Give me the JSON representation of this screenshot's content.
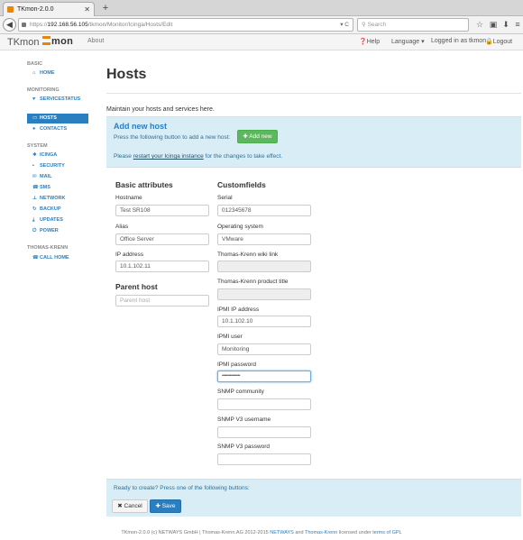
{
  "browser": {
    "tab_title": "TKmon-2.0.0",
    "url_scheme": "https://",
    "url_host": "192.168.56.105",
    "url_path": "/tkmon/Monitor/Icinga/Hosts/Edit",
    "url_controls": "▾ C",
    "search_placeholder": "Search"
  },
  "app": {
    "brand": "TKmon",
    "logo": "mon",
    "nav_about": "About",
    "nav_help": "Help",
    "nav_language": "Language",
    "nav_logged_in": "Logged in as tkmon",
    "nav_logout": "Logout"
  },
  "sidebar": {
    "sections": [
      {
        "header": "BASIC",
        "items": [
          {
            "label": "HOME",
            "icon": "home-icon"
          }
        ]
      },
      {
        "header": "MONITORING",
        "items": [
          {
            "label": "SERVICESTATUS",
            "icon": "heart-icon"
          }
        ]
      },
      {
        "header": "",
        "items": [
          {
            "label": "HOSTS",
            "icon": "monitor-icon",
            "active": true
          },
          {
            "label": "CONTACTS",
            "icon": "user-icon"
          }
        ]
      },
      {
        "header": "SYSTEM",
        "items": [
          {
            "label": "ICINGA",
            "icon": "icinga-icon"
          },
          {
            "label": "SECURITY",
            "icon": "lock-icon"
          },
          {
            "label": "MAIL",
            "icon": "mail-icon"
          },
          {
            "label": "SMS",
            "icon": "phone-icon"
          },
          {
            "label": "NETWORK",
            "icon": "network-icon"
          },
          {
            "label": "BACKUP",
            "icon": "refresh-icon"
          },
          {
            "label": "UPDATES",
            "icon": "download-icon"
          },
          {
            "label": "POWER",
            "icon": "power-icon"
          }
        ]
      },
      {
        "header": "THOMAS-KRENN",
        "items": [
          {
            "label": "CALL HOME",
            "icon": "phone-icon"
          }
        ]
      }
    ]
  },
  "main": {
    "title": "Hosts",
    "intro": "Maintain your hosts and services here.",
    "add": {
      "title": "Add new host",
      "desc": "Press the following button to add a new host:",
      "button": "Add new",
      "note_pre": "Please ",
      "note_link": "restart your Icinga instance",
      "note_post": " for the changes to take effect."
    },
    "basic": {
      "title": "Basic attributes",
      "hostname_label": "Hostname",
      "hostname_value": "Test SR108",
      "alias_label": "Alias",
      "alias_value": "Office Server",
      "ip_label": "IP address",
      "ip_value": "10.1.102.11"
    },
    "parent": {
      "title": "Parent host",
      "placeholder": "Parent host"
    },
    "custom": {
      "title": "Customfields",
      "serial_label": "Serial",
      "serial_value": "012345678",
      "os_label": "Operating system",
      "os_value": "VMware",
      "wiki_label": "Thomas-Krenn wiki link",
      "wiki_value": "",
      "product_label": "Thomas-Krenn product title",
      "product_value": "",
      "ipmi_ip_label": "IPMI IP address",
      "ipmi_ip_value": "10.1.102.10",
      "ipmi_user_label": "IPMI user",
      "ipmi_user_value": "Monitoring",
      "ipmi_pw_label": "IPMI password",
      "ipmi_pw_value": "••••••••••••••••",
      "snmp_comm_label": "SNMP community",
      "snmp_comm_value": "",
      "snmp_v3_user_label": "SNMP V3 username",
      "snmp_v3_user_value": "",
      "snmp_v3_pw_label": "SNMP V3 password",
      "snmp_v3_pw_value": ""
    },
    "save": {
      "desc": "Ready to create? Press one of the following buttons:",
      "cancel": "Cancel",
      "save": "Save"
    }
  },
  "footer": {
    "text1": "TKmon-2.0.0 (c) NETWAYS GmbH | Thomas-Krenn.AG 2012-2015 ",
    "link1": "NETWAYS",
    "text2": " and ",
    "link2": "Thomas-Krenn",
    "text3": " licensed under ",
    "link3": "terms of GPL"
  },
  "colors": {
    "brand_orange": "#e8860c",
    "link_blue": "#2a7fc0",
    "info_bg": "#d9edf7",
    "success_green": "#5cb85c"
  }
}
